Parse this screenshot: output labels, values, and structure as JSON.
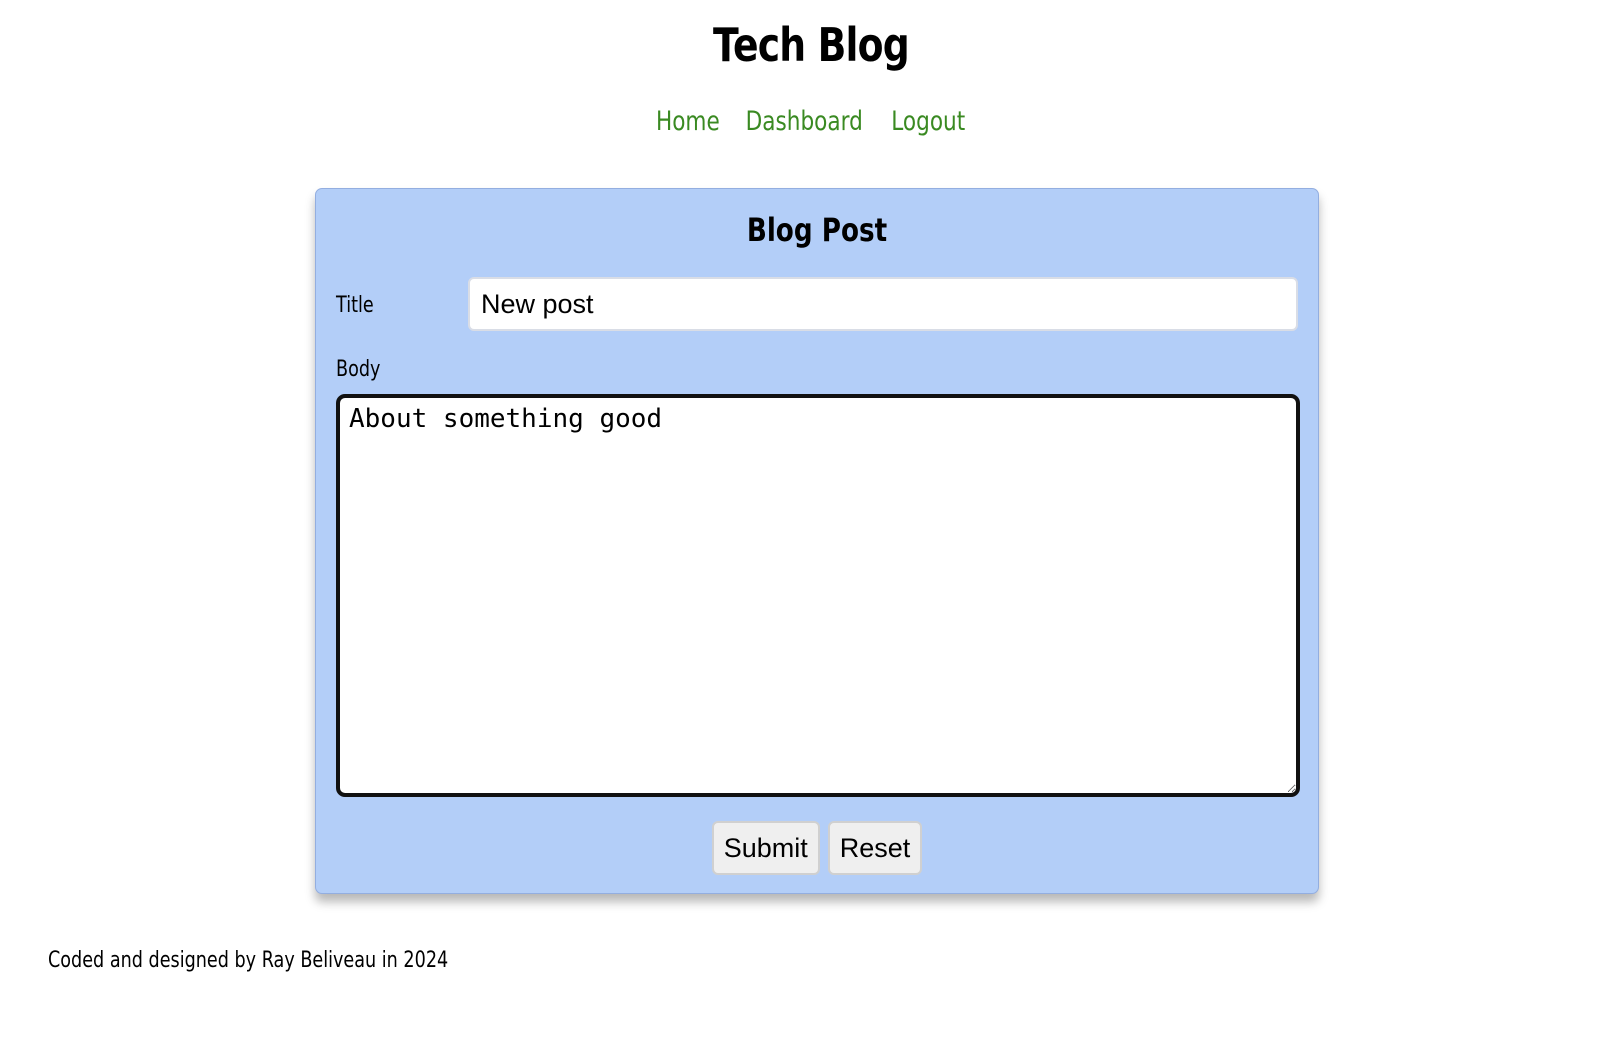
{
  "header": {
    "title": "Tech Blog",
    "nav": [
      {
        "label": "Home"
      },
      {
        "label": "Dashboard"
      },
      {
        "label": "Logout"
      }
    ]
  },
  "form": {
    "heading": "Blog Post",
    "title_label": "Title",
    "title_value": "New post",
    "body_label": "Body",
    "body_value": "About something good",
    "submit_label": "Submit",
    "reset_label": "Reset"
  },
  "footer": {
    "text": "Coded and designed by Ray Beliveau in 2024"
  },
  "colors": {
    "nav_link": "#3a8a22",
    "card_background": "#b3cef8"
  }
}
